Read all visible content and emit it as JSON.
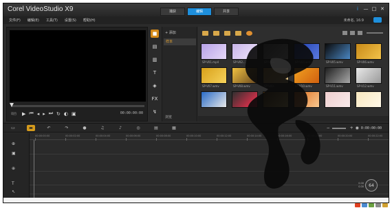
{
  "app": {
    "title": "Corel VideoStudio X9",
    "tabs": [
      {
        "label": "捕获",
        "active": false
      },
      {
        "label": "编辑",
        "active": true
      },
      {
        "label": "共享",
        "active": false
      }
    ],
    "window_controls": [
      "i",
      "—",
      "□",
      "✕"
    ]
  },
  "menu": {
    "items": [
      "文件(F)",
      "编辑(E)",
      "工具(T)",
      "设置(S)",
      "帮助(H)"
    ],
    "project_name": "未命名, 16:9",
    "accent_color": "#1e8fdc"
  },
  "preview": {
    "clip_label": "项目",
    "timecode": "00:00:00:00",
    "controls": [
      "play-icon",
      "prev-frame-icon",
      "previous-icon",
      "next-icon",
      "next-frame-icon",
      "repeat-icon",
      "volume-icon",
      "hd-icon"
    ]
  },
  "library": {
    "add_label": "添加",
    "folder": "样本",
    "browse_label": "浏览",
    "items": [
      {
        "name": "SP-V01.mp4",
        "colors": [
          "#b7a2e8",
          "#e6d8f7"
        ]
      },
      {
        "name": "SP-V02...",
        "colors": [
          "#c8b5e8",
          "#f0e6fb"
        ]
      },
      {
        "name": "SP-V03...",
        "colors": [
          "#6a6a6a",
          "#cfcfcf"
        ]
      },
      {
        "name": "SP-V04.wmv",
        "colors": [
          "#1f3fb0",
          "#5b7ae0"
        ]
      },
      {
        "name": "SP-V05.wmv",
        "colors": [
          "#0b0b0b",
          "#4a86c2"
        ]
      },
      {
        "name": "SP-V06.wmv",
        "colors": [
          "#c88a18",
          "#f2c24a"
        ]
      },
      {
        "name": "SP-V07.wmv",
        "colors": [
          "#d8a01a",
          "#f6d35c"
        ]
      },
      {
        "name": "SP-V08.wmv",
        "colors": [
          "#f0c040",
          "#6a4a20"
        ]
      },
      {
        "name": "SP-V09...",
        "colors": [
          "#b58a40",
          "#dcc08a"
        ]
      },
      {
        "name": "SP-V10.wmv",
        "colors": [
          "#f0a020",
          "#d06010"
        ]
      },
      {
        "name": "SP-V11.wmv",
        "colors": [
          "#202020",
          "#a8a8a8"
        ]
      },
      {
        "name": "SP-V12.wmv",
        "colors": [
          "#e8e8e8",
          "#9a9a9a"
        ]
      },
      {
        "name": "",
        "colors": [
          "#2a6cc8",
          "#e8e8e8"
        ]
      },
      {
        "name": "",
        "colors": [
          "#303030",
          "#ff3050"
        ]
      },
      {
        "name": "",
        "colors": [
          "#5a3a10",
          "#e8d080"
        ]
      },
      {
        "name": "",
        "colors": [
          "#e07020",
          "#f8c890"
        ]
      },
      {
        "name": "",
        "colors": [
          "#f0d0d0",
          "#f8eaea"
        ]
      },
      {
        "name": "",
        "colors": [
          "#f8e8c0",
          "#fff8e8"
        ]
      }
    ]
  },
  "timeline": {
    "timecode": "0:00:00:00",
    "ruler": [
      "00:00:00:00",
      "00:00:02:00",
      "00:00:04:00",
      "00:00:06:00",
      "00:00:08:00",
      "00:00:10:00",
      "00:00:12:00",
      "00:00:14:00",
      "00:00:16:00",
      "00:00:18:00",
      "00:00:20:00",
      "00:00:22:00"
    ],
    "disc_label": "64",
    "stats_top": "0.00",
    "stats_bottom": "0.00"
  }
}
